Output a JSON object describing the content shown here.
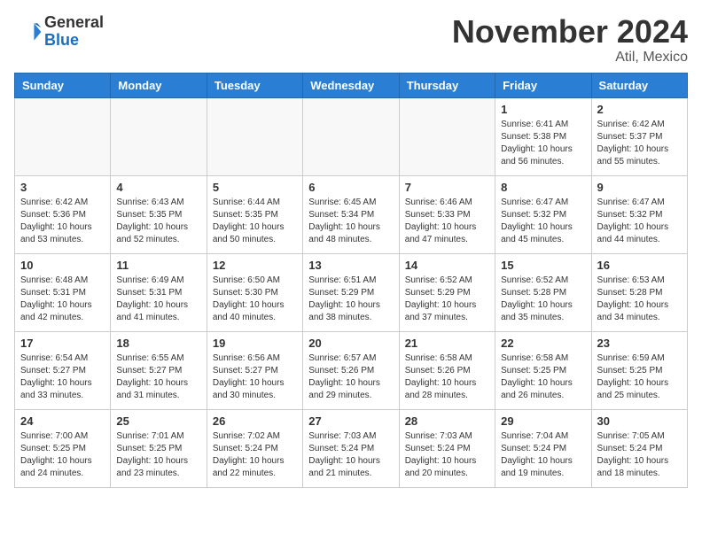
{
  "header": {
    "logo_general": "General",
    "logo_blue": "Blue",
    "month_title": "November 2024",
    "location": "Atil, Mexico"
  },
  "weekdays": [
    "Sunday",
    "Monday",
    "Tuesday",
    "Wednesday",
    "Thursday",
    "Friday",
    "Saturday"
  ],
  "weeks": [
    [
      {
        "day": null
      },
      {
        "day": null
      },
      {
        "day": null
      },
      {
        "day": null
      },
      {
        "day": null
      },
      {
        "day": "1",
        "sunrise": "Sunrise: 6:41 AM",
        "sunset": "Sunset: 5:38 PM",
        "daylight": "Daylight: 10 hours and 56 minutes."
      },
      {
        "day": "2",
        "sunrise": "Sunrise: 6:42 AM",
        "sunset": "Sunset: 5:37 PM",
        "daylight": "Daylight: 10 hours and 55 minutes."
      }
    ],
    [
      {
        "day": "3",
        "sunrise": "Sunrise: 6:42 AM",
        "sunset": "Sunset: 5:36 PM",
        "daylight": "Daylight: 10 hours and 53 minutes."
      },
      {
        "day": "4",
        "sunrise": "Sunrise: 6:43 AM",
        "sunset": "Sunset: 5:35 PM",
        "daylight": "Daylight: 10 hours and 52 minutes."
      },
      {
        "day": "5",
        "sunrise": "Sunrise: 6:44 AM",
        "sunset": "Sunset: 5:35 PM",
        "daylight": "Daylight: 10 hours and 50 minutes."
      },
      {
        "day": "6",
        "sunrise": "Sunrise: 6:45 AM",
        "sunset": "Sunset: 5:34 PM",
        "daylight": "Daylight: 10 hours and 48 minutes."
      },
      {
        "day": "7",
        "sunrise": "Sunrise: 6:46 AM",
        "sunset": "Sunset: 5:33 PM",
        "daylight": "Daylight: 10 hours and 47 minutes."
      },
      {
        "day": "8",
        "sunrise": "Sunrise: 6:47 AM",
        "sunset": "Sunset: 5:32 PM",
        "daylight": "Daylight: 10 hours and 45 minutes."
      },
      {
        "day": "9",
        "sunrise": "Sunrise: 6:47 AM",
        "sunset": "Sunset: 5:32 PM",
        "daylight": "Daylight: 10 hours and 44 minutes."
      }
    ],
    [
      {
        "day": "10",
        "sunrise": "Sunrise: 6:48 AM",
        "sunset": "Sunset: 5:31 PM",
        "daylight": "Daylight: 10 hours and 42 minutes."
      },
      {
        "day": "11",
        "sunrise": "Sunrise: 6:49 AM",
        "sunset": "Sunset: 5:31 PM",
        "daylight": "Daylight: 10 hours and 41 minutes."
      },
      {
        "day": "12",
        "sunrise": "Sunrise: 6:50 AM",
        "sunset": "Sunset: 5:30 PM",
        "daylight": "Daylight: 10 hours and 40 minutes."
      },
      {
        "day": "13",
        "sunrise": "Sunrise: 6:51 AM",
        "sunset": "Sunset: 5:29 PM",
        "daylight": "Daylight: 10 hours and 38 minutes."
      },
      {
        "day": "14",
        "sunrise": "Sunrise: 6:52 AM",
        "sunset": "Sunset: 5:29 PM",
        "daylight": "Daylight: 10 hours and 37 minutes."
      },
      {
        "day": "15",
        "sunrise": "Sunrise: 6:52 AM",
        "sunset": "Sunset: 5:28 PM",
        "daylight": "Daylight: 10 hours and 35 minutes."
      },
      {
        "day": "16",
        "sunrise": "Sunrise: 6:53 AM",
        "sunset": "Sunset: 5:28 PM",
        "daylight": "Daylight: 10 hours and 34 minutes."
      }
    ],
    [
      {
        "day": "17",
        "sunrise": "Sunrise: 6:54 AM",
        "sunset": "Sunset: 5:27 PM",
        "daylight": "Daylight: 10 hours and 33 minutes."
      },
      {
        "day": "18",
        "sunrise": "Sunrise: 6:55 AM",
        "sunset": "Sunset: 5:27 PM",
        "daylight": "Daylight: 10 hours and 31 minutes."
      },
      {
        "day": "19",
        "sunrise": "Sunrise: 6:56 AM",
        "sunset": "Sunset: 5:27 PM",
        "daylight": "Daylight: 10 hours and 30 minutes."
      },
      {
        "day": "20",
        "sunrise": "Sunrise: 6:57 AM",
        "sunset": "Sunset: 5:26 PM",
        "daylight": "Daylight: 10 hours and 29 minutes."
      },
      {
        "day": "21",
        "sunrise": "Sunrise: 6:58 AM",
        "sunset": "Sunset: 5:26 PM",
        "daylight": "Daylight: 10 hours and 28 minutes."
      },
      {
        "day": "22",
        "sunrise": "Sunrise: 6:58 AM",
        "sunset": "Sunset: 5:25 PM",
        "daylight": "Daylight: 10 hours and 26 minutes."
      },
      {
        "day": "23",
        "sunrise": "Sunrise: 6:59 AM",
        "sunset": "Sunset: 5:25 PM",
        "daylight": "Daylight: 10 hours and 25 minutes."
      }
    ],
    [
      {
        "day": "24",
        "sunrise": "Sunrise: 7:00 AM",
        "sunset": "Sunset: 5:25 PM",
        "daylight": "Daylight: 10 hours and 24 minutes."
      },
      {
        "day": "25",
        "sunrise": "Sunrise: 7:01 AM",
        "sunset": "Sunset: 5:25 PM",
        "daylight": "Daylight: 10 hours and 23 minutes."
      },
      {
        "day": "26",
        "sunrise": "Sunrise: 7:02 AM",
        "sunset": "Sunset: 5:24 PM",
        "daylight": "Daylight: 10 hours and 22 minutes."
      },
      {
        "day": "27",
        "sunrise": "Sunrise: 7:03 AM",
        "sunset": "Sunset: 5:24 PM",
        "daylight": "Daylight: 10 hours and 21 minutes."
      },
      {
        "day": "28",
        "sunrise": "Sunrise: 7:03 AM",
        "sunset": "Sunset: 5:24 PM",
        "daylight": "Daylight: 10 hours and 20 minutes."
      },
      {
        "day": "29",
        "sunrise": "Sunrise: 7:04 AM",
        "sunset": "Sunset: 5:24 PM",
        "daylight": "Daylight: 10 hours and 19 minutes."
      },
      {
        "day": "30",
        "sunrise": "Sunrise: 7:05 AM",
        "sunset": "Sunset: 5:24 PM",
        "daylight": "Daylight: 10 hours and 18 minutes."
      }
    ]
  ]
}
